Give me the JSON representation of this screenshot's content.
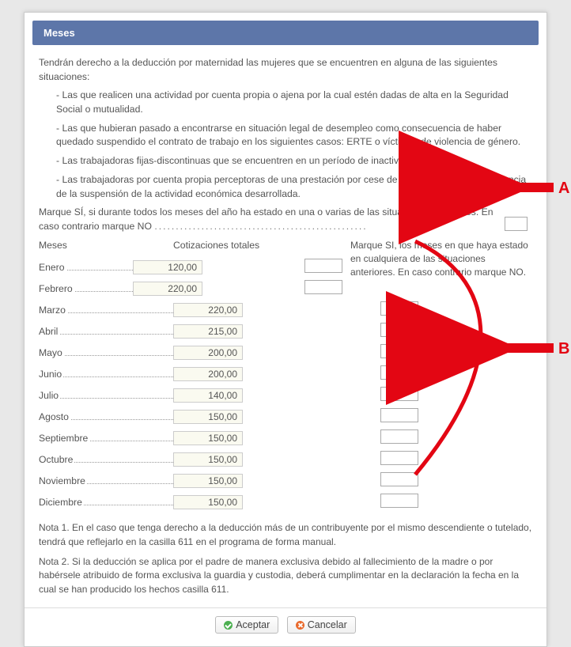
{
  "dialog": {
    "title": "Meses",
    "intro": "Tendrán derecho a la deducción por maternidad las mujeres que se encuentren en alguna de las siguientes situaciones:",
    "bullets": [
      "Las que realicen una actividad por cuenta propia o ajena por la cual estén dadas de alta en la Seguridad Social o mutualidad.",
      "Las que hubieran pasado a encontrarse en situación legal de desempleo como consecuencia de haber quedado suspendido el contrato de trabajo en los siguientes casos: ERTE o víctimas de violencia de género.",
      "Las trabajadoras fijas-discontinuas que se encuentren en un período de inactividad productiva.",
      "Las trabajadoras por cuenta propia perceptoras de una prestación por cese de actividad como consecuencia de la suspensión de la actividad económica desarrollada."
    ],
    "marque_si_all": "Marque SÍ, si durante todos los meses del año ha estado en una o varias de las situaciones anteriores. En caso contrario marque NO",
    "marque_si_month": "Marque SI, los meses en que haya estado en cualquiera de las situaciones anteriores. En caso contrario marque NO.",
    "headers": {
      "meses": "Meses",
      "cotizaciones": "Cotizaciones totales"
    },
    "rows": [
      {
        "mes": "Enero",
        "cot": "120,00"
      },
      {
        "mes": "Febrero",
        "cot": "220,00"
      },
      {
        "mes": "Marzo",
        "cot": "220,00"
      },
      {
        "mes": "Abril",
        "cot": "215,00"
      },
      {
        "mes": "Mayo",
        "cot": "200,00"
      },
      {
        "mes": "Junio",
        "cot": "200,00"
      },
      {
        "mes": "Julio",
        "cot": "140,00"
      },
      {
        "mes": "Agosto",
        "cot": "150,00"
      },
      {
        "mes": "Septiembre",
        "cot": "150,00"
      },
      {
        "mes": "Octubre",
        "cot": "150,00"
      },
      {
        "mes": "Noviembre",
        "cot": "150,00"
      },
      {
        "mes": "Diciembre",
        "cot": "150,00"
      }
    ],
    "nota1": "Nota 1. En el caso que tenga derecho a la deducción más de un contribuyente por el mismo descendiente o tutelado, tendrá que reflejarlo en la casilla 611 en el programa de forma manual.",
    "nota2": "Nota 2. Si la deducción se aplica por el padre de manera exclusiva debido al fallecimiento de la madre o por habérsele atribuido de forma exclusiva la guardia y custodia, deberá cumplimentar en la declaración la fecha en la cual se han producido los hechos casilla 611.",
    "buttons": {
      "accept": "Aceptar",
      "cancel": "Cancelar"
    }
  },
  "annotations": {
    "labelA": "A",
    "labelB": "B"
  }
}
